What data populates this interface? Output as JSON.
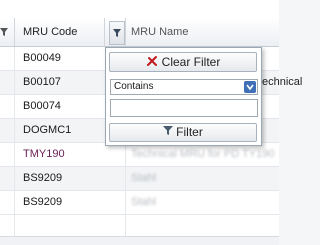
{
  "header": {
    "code_column": "MRU Code",
    "name_column": "MRU Name"
  },
  "rows": [
    {
      "code": "B00049",
      "name": "s"
    },
    {
      "code": "B00107",
      "name": "echnical"
    },
    {
      "code": "B00074",
      "name": ""
    },
    {
      "code": "DOGMC1",
      "name": ""
    },
    {
      "code": "TMY190",
      "name": "Technical MRU for PD TY190"
    },
    {
      "code": "BS9209",
      "name": "Stahl"
    },
    {
      "code": "BS9209",
      "name": "Stahl"
    }
  ],
  "filter_popup": {
    "clear_label": "Clear Filter",
    "operator": "Contains",
    "value": "",
    "filter_label": "Filter"
  },
  "colors": {
    "clear_icon": "#c0181c",
    "purple_text": "#6a1f55"
  }
}
